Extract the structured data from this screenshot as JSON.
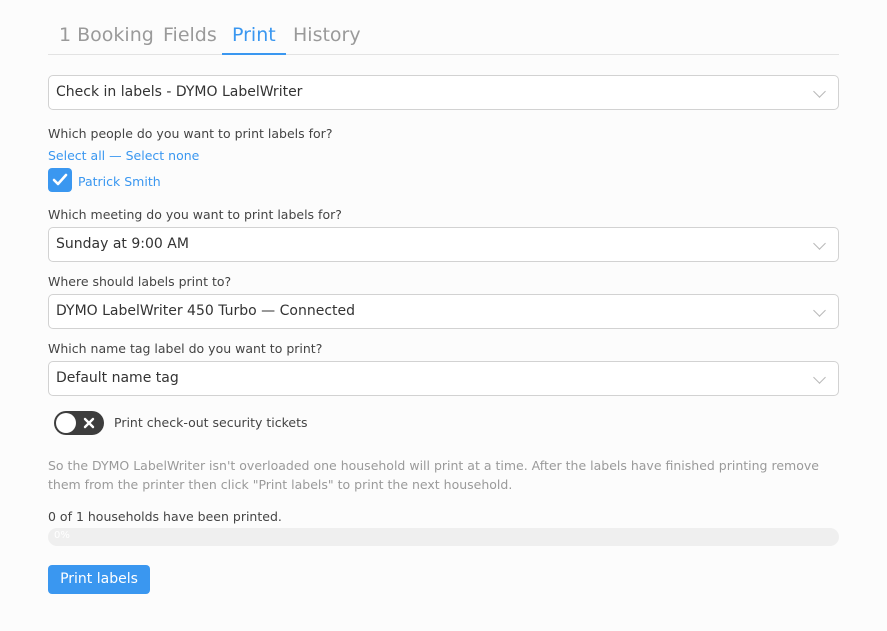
{
  "tabs": [
    {
      "label": "1 Booking",
      "active": false
    },
    {
      "label": "Fields",
      "active": false
    },
    {
      "label": "Print",
      "active": true
    },
    {
      "label": "History",
      "active": false
    }
  ],
  "label_set_select": {
    "value": "Check in labels - DYMO LabelWriter"
  },
  "people": {
    "question": "Which people do you want to print labels for?",
    "select_all": "Select all",
    "separator": "—",
    "select_none": "Select none",
    "list": [
      {
        "name": "Patrick Smith",
        "checked": true
      }
    ]
  },
  "meeting": {
    "question": "Which meeting do you want to print labels for?",
    "value": "Sunday at 9:00 AM"
  },
  "printer": {
    "question": "Where should labels print to?",
    "value": "DYMO LabelWriter 450 Turbo — Connected"
  },
  "name_tag": {
    "question": "Which name tag label do you want to print?",
    "value": "Default name tag"
  },
  "security_toggle": {
    "label": "Print check-out security tickets",
    "on": false
  },
  "note": "So the DYMO LabelWriter isn't overloaded one household will print at a time. After the labels have finished printing remove them from the printer then click \"Print labels\" to print the next household.",
  "progress": {
    "status": "0 of 1 households have been printed.",
    "percent_label": "0%",
    "fraction": 0
  },
  "print_button": "Print labels",
  "colors": {
    "accent": "#3a97f0",
    "toggle_off": "#3d3d3d"
  }
}
